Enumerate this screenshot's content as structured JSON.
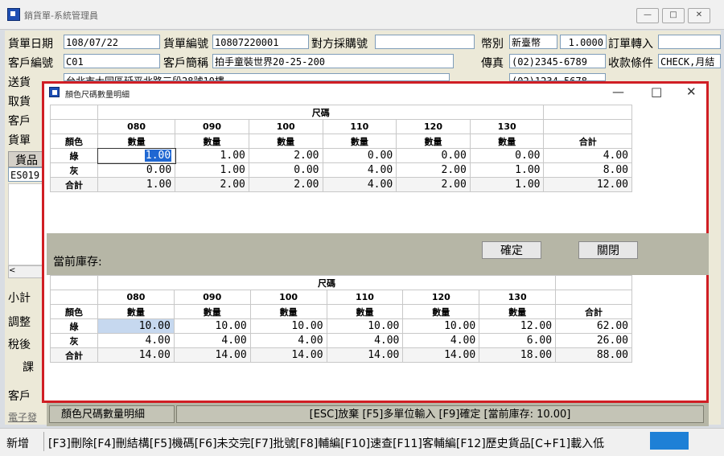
{
  "main": {
    "title": "銷貨單-系統管理員",
    "win_min": "—",
    "win_max": "□",
    "win_close": "✕",
    "labels": {
      "date": "貨單日期",
      "no": "貨單編號",
      "po": "對方採購號",
      "currency": "幣別",
      "order_convert": "訂單轉入",
      "cust_no": "客戶編號",
      "cust_name": "客戶簡稱",
      "fax": "傳真",
      "payment": "收款條件",
      "r3": "送貨",
      "r4": "取貨",
      "r5": "客戶",
      "r6": "貨單",
      "subtotal": "小計",
      "adjust": "調整",
      "after_tax": "稅後",
      "tax": "課",
      "cust2": "客戶",
      "einv": "電子發"
    },
    "values": {
      "date": "108/07/22",
      "no": "10807220001",
      "po": "",
      "currency": "新臺幣",
      "rate": "1.0000",
      "order_convert": "",
      "cust_no": "C01",
      "cust_name": "拍手童裝世界20-25-200",
      "fax": "(02)2345-6789",
      "payment": "CHECK,月結",
      "address_partial": "台北市大同區延平北路三段28號10樓",
      "phone_partial": "(02)1234-5678",
      "col_header": "貨品",
      "item_code": "ES019"
    }
  },
  "statusbar": {
    "new": "新增",
    "shortcuts": "[F3]刪除[F4]刪結構[F5]機碼[F6]未交完[F7]批號[F8]輔編[F10]速查[F11]客輔編[F12]歷史貨品[C+F1]載入低"
  },
  "dialog": {
    "title": "顏色尺碼數量明細",
    "min": "—",
    "max": "□",
    "close": "✕",
    "current_stock_label": "當前庫存:",
    "ok_button": "確定",
    "close_button": "關閉",
    "bottom_panel_title": "顏色尺碼數量明細",
    "bottom_panel_hint": "[ESC]放棄 [F5]多單位輸入 [F9]確定 [當前庫存: 10.00]",
    "grid_top": {
      "size_header": "尺碼",
      "sizes": [
        "080",
        "090",
        "100",
        "110",
        "120",
        "130"
      ],
      "qty_label": "數量",
      "color_label": "顏色",
      "total_label": "合計",
      "rows": [
        {
          "color": "綠",
          "values": [
            "1.00",
            "1.00",
            "2.00",
            "0.00",
            "0.00",
            "0.00"
          ],
          "total": "4.00"
        },
        {
          "color": "灰",
          "values": [
            "0.00",
            "1.00",
            "0.00",
            "4.00",
            "2.00",
            "1.00"
          ],
          "total": "8.00"
        }
      ],
      "sum": {
        "label": "合計",
        "values": [
          "1.00",
          "2.00",
          "2.00",
          "4.00",
          "2.00",
          "1.00"
        ],
        "total": "12.00"
      }
    },
    "grid_bottom": {
      "size_header": "尺碼",
      "sizes": [
        "080",
        "090",
        "100",
        "110",
        "120",
        "130"
      ],
      "qty_label": "數量",
      "color_label": "顏色",
      "total_label": "合計",
      "rows": [
        {
          "color": "綠",
          "values": [
            "10.00",
            "10.00",
            "10.00",
            "10.00",
            "10.00",
            "12.00"
          ],
          "total": "62.00"
        },
        {
          "color": "灰",
          "values": [
            "4.00",
            "4.00",
            "4.00",
            "4.00",
            "4.00",
            "6.00"
          ],
          "total": "26.00"
        }
      ],
      "sum": {
        "label": "合計",
        "values": [
          "14.00",
          "14.00",
          "14.00",
          "14.00",
          "14.00",
          "18.00"
        ],
        "total": "88.00"
      }
    }
  }
}
